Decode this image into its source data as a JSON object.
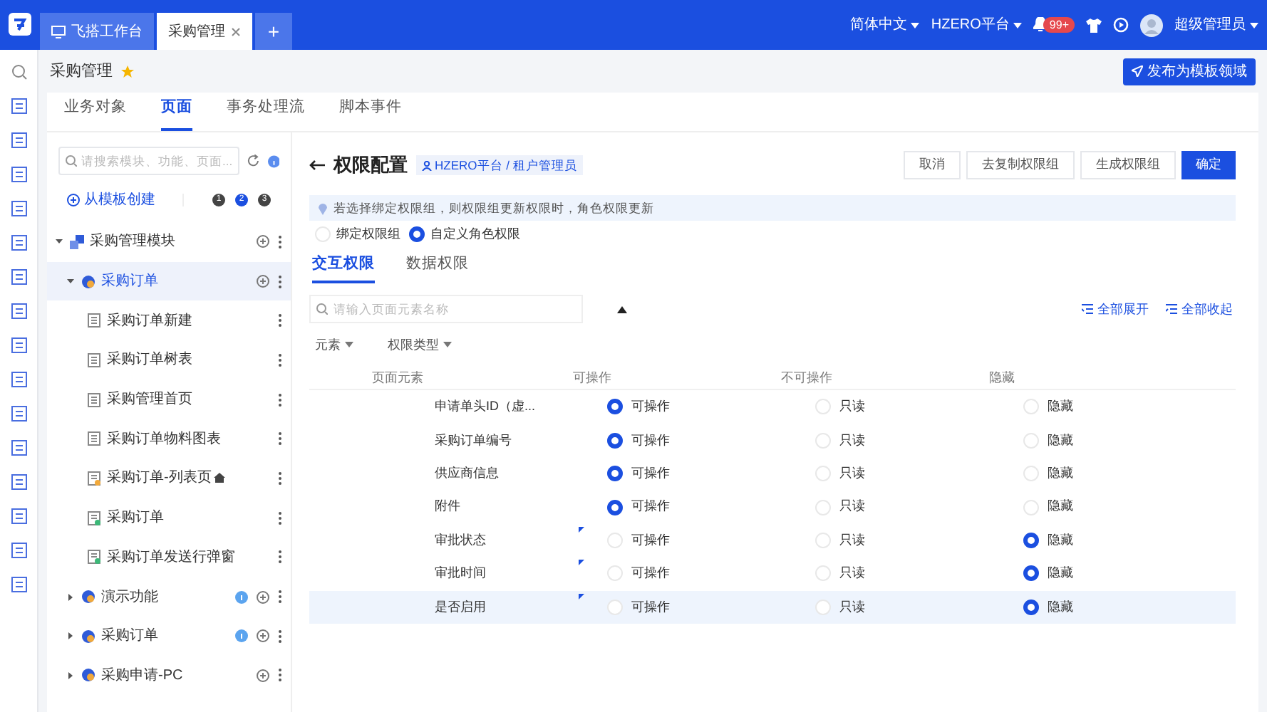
{
  "topbar": {
    "tabs": [
      {
        "label": "飞搭工作台",
        "selected": false,
        "closable": false
      },
      {
        "label": "采购管理",
        "selected": true,
        "closable": true
      }
    ],
    "add_tab": "+",
    "language": "简体中文",
    "platform": "HZERO平台",
    "notification_badge": "99+",
    "user": "超级管理员"
  },
  "breadcrumb": {
    "title": "采购管理",
    "starred": true,
    "publish_button": "发布为模板领域"
  },
  "tabs": [
    {
      "label": "业务对象",
      "selected": false
    },
    {
      "label": "页面",
      "selected": true
    },
    {
      "label": "事务处理流",
      "selected": false
    },
    {
      "label": "脚本事件",
      "selected": false
    }
  ],
  "sidebar": {
    "search_placeholder": "请搜索模块、功能、页面...",
    "create_from_template": "从模板创建",
    "steps": [
      {
        "label": "1",
        "selected": false
      },
      {
        "label": "2",
        "selected": true
      },
      {
        "label": "3",
        "selected": false
      }
    ],
    "tree": [
      {
        "label": "采购管理模块",
        "kind": "module",
        "expanded": true,
        "selected": false,
        "addable": true,
        "children": [
          {
            "label": "采购订单",
            "kind": "function",
            "expanded": true,
            "selected": true,
            "addable": true,
            "children": [
              {
                "label": "采购订单新建",
                "kind": "page"
              },
              {
                "label": "采购订单树表",
                "kind": "page"
              },
              {
                "label": "采购管理首页",
                "kind": "page"
              },
              {
                "label": "采购订单物料图表",
                "kind": "page"
              },
              {
                "label": "采购订单-列表页",
                "kind": "page_home"
              },
              {
                "label": "采购订单",
                "kind": "page_green"
              },
              {
                "label": "采购订单发送行弹窗",
                "kind": "page_green"
              }
            ]
          },
          {
            "label": "演示功能",
            "kind": "function",
            "expanded": false,
            "selected": false,
            "addable": true,
            "badge": true
          },
          {
            "label": "采购订单",
            "kind": "function",
            "expanded": false,
            "selected": false,
            "addable": true,
            "badge": true
          },
          {
            "label": "采购申请-PC",
            "kind": "function",
            "expanded": false,
            "selected": false,
            "addable": true
          }
        ]
      }
    ]
  },
  "main": {
    "title": "权限配置",
    "role_tag": "HZERO平台 / 租户管理员",
    "buttons": [
      {
        "label": "取消",
        "primary": false
      },
      {
        "label": "去复制权限组",
        "primary": false
      },
      {
        "label": "生成权限组",
        "primary": false
      },
      {
        "label": "确定",
        "primary": true
      }
    ],
    "notice": "若选择绑定权限组，则权限组更新权限时，角色权限更新",
    "modes": [
      {
        "label": "绑定权限组",
        "selected": false
      },
      {
        "label": "自定义角色权限",
        "selected": true
      }
    ],
    "subtabs": [
      {
        "label": "交互权限",
        "selected": true
      },
      {
        "label": "数据权限",
        "selected": false
      }
    ],
    "search_placeholder": "请输入页面元素名称",
    "expand_all": "全部展开",
    "collapse_all": "全部收起",
    "filters": [
      "元素",
      "权限类型"
    ],
    "table": {
      "columns": [
        "页面元素",
        "可操作",
        "不可操作",
        "隐藏"
      ],
      "rows": [
        {
          "name": "申请单头ID（虚...",
          "flag": false,
          "selected_row": false,
          "options": [
            {
              "label": "可操作",
              "selected": true
            },
            {
              "label": "只读",
              "selected": false
            },
            {
              "label": "隐藏",
              "selected": false
            }
          ]
        },
        {
          "name": "采购订单编号",
          "flag": false,
          "selected_row": false,
          "options": [
            {
              "label": "可操作",
              "selected": true
            },
            {
              "label": "只读",
              "selected": false
            },
            {
              "label": "隐藏",
              "selected": false
            }
          ]
        },
        {
          "name": "供应商信息",
          "flag": false,
          "selected_row": false,
          "options": [
            {
              "label": "可操作",
              "selected": true
            },
            {
              "label": "只读",
              "selected": false
            },
            {
              "label": "隐藏",
              "selected": false
            }
          ]
        },
        {
          "name": "附件",
          "flag": false,
          "selected_row": false,
          "options": [
            {
              "label": "可操作",
              "selected": true
            },
            {
              "label": "只读",
              "selected": false
            },
            {
              "label": "隐藏",
              "selected": false
            }
          ]
        },
        {
          "name": "审批状态",
          "flag": true,
          "selected_row": false,
          "options": [
            {
              "label": "可操作",
              "selected": false
            },
            {
              "label": "只读",
              "selected": false
            },
            {
              "label": "隐藏",
              "selected": true
            }
          ]
        },
        {
          "name": "审批时间",
          "flag": true,
          "selected_row": false,
          "options": [
            {
              "label": "可操作",
              "selected": false
            },
            {
              "label": "只读",
              "selected": false
            },
            {
              "label": "隐藏",
              "selected": true
            }
          ]
        },
        {
          "name": "是否启用",
          "flag": true,
          "selected_row": true,
          "options": [
            {
              "label": "可操作",
              "selected": false
            },
            {
              "label": "只读",
              "selected": false
            },
            {
              "label": "隐藏",
              "selected": true
            }
          ]
        }
      ]
    }
  }
}
